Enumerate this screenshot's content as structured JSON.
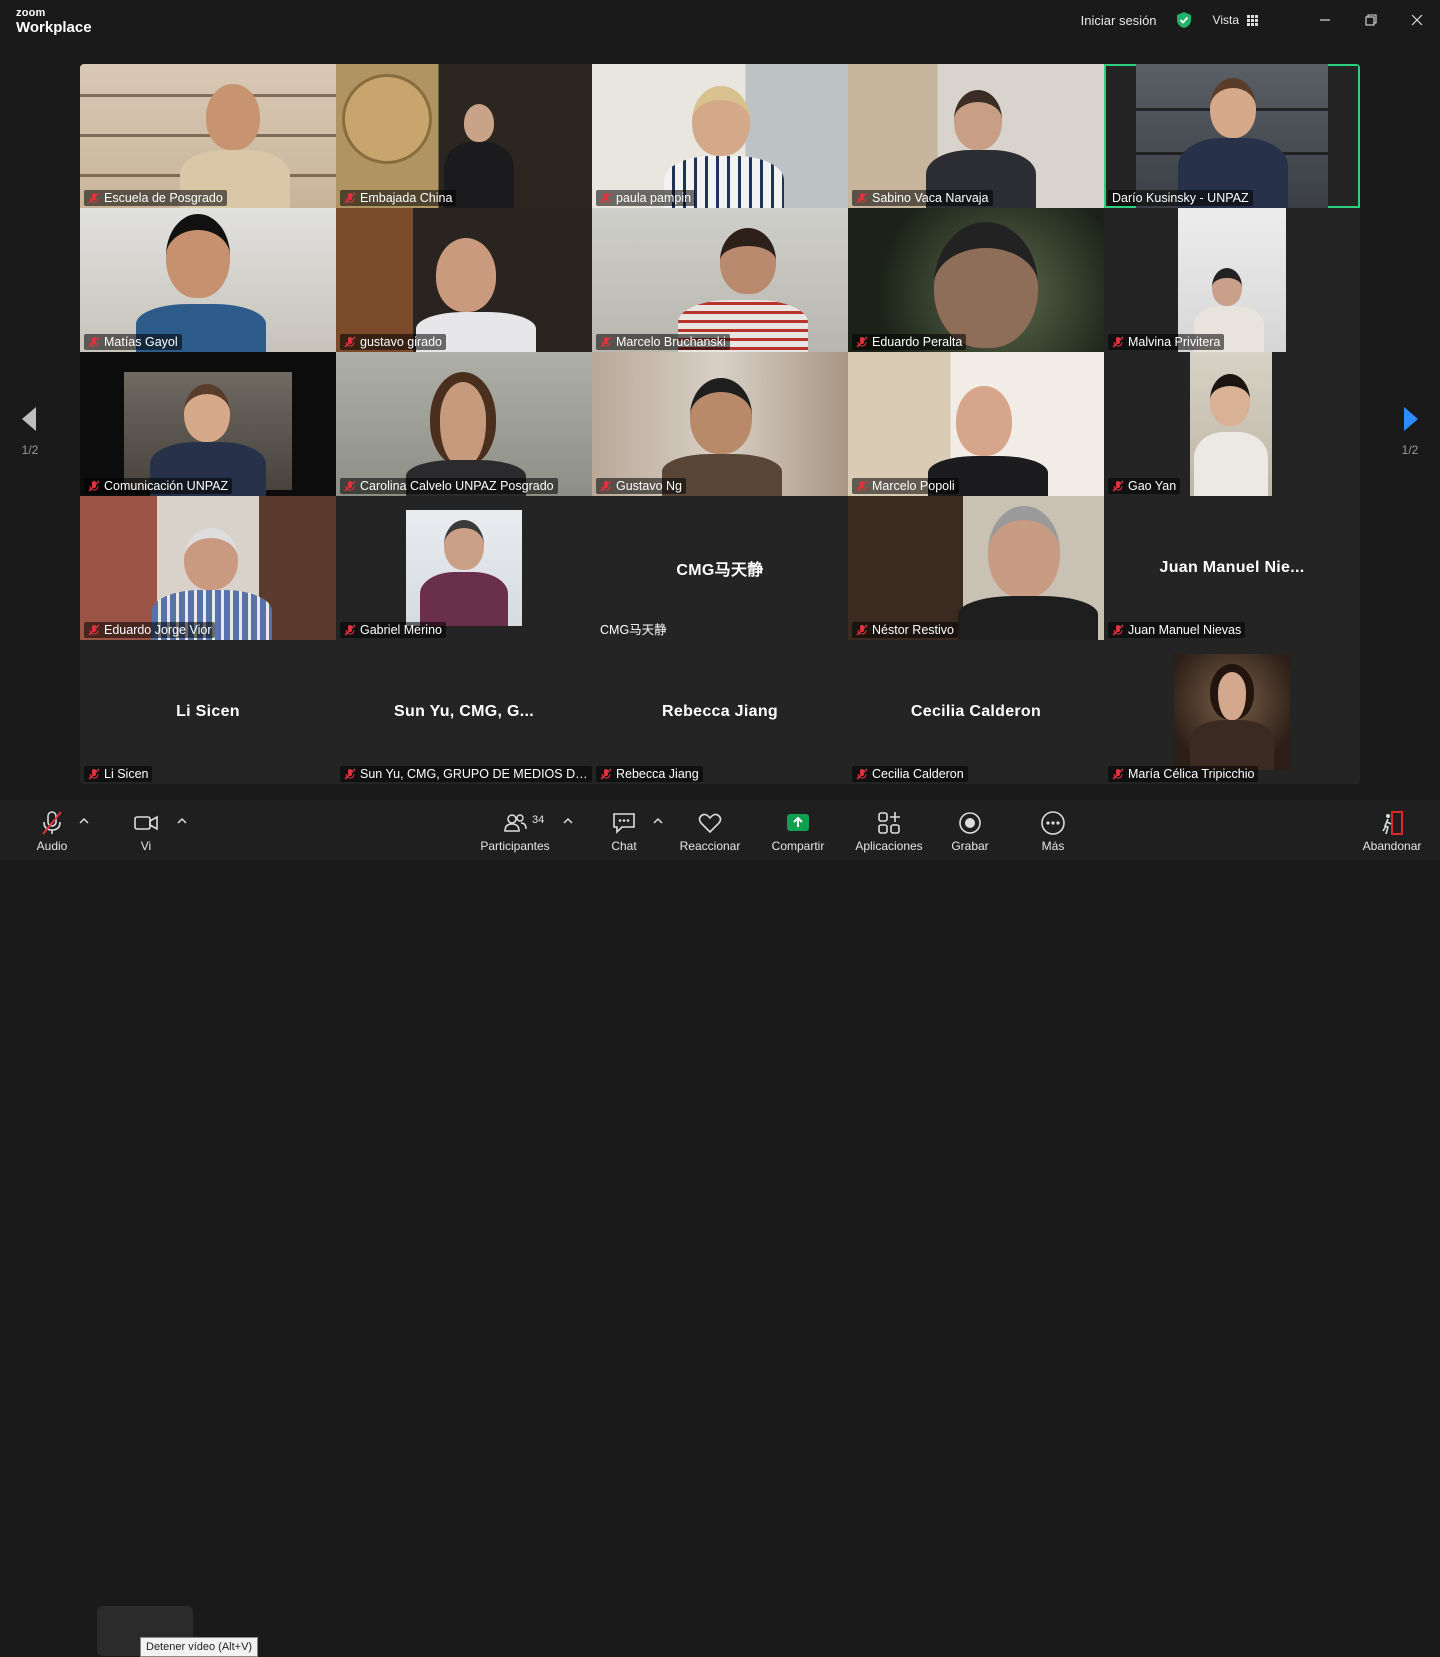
{
  "app": {
    "brand_small": "zoom",
    "brand_large": "Workplace"
  },
  "titlebar": {
    "signin": "Iniciar sesión",
    "view": "Vista"
  },
  "pager": {
    "left": "1/2",
    "right": "1/2"
  },
  "participants": [
    {
      "name": "Escuela de Posgrado",
      "muted": true,
      "video": true
    },
    {
      "name": "Embajada China",
      "muted": true,
      "video": true
    },
    {
      "name": "paula pampin",
      "muted": true,
      "video": true
    },
    {
      "name": "Sabino Vaca Narvaja",
      "muted": true,
      "video": true
    },
    {
      "name": "Darío Kusinsky - UNPAZ",
      "muted": false,
      "video": true,
      "active": true
    },
    {
      "name": "Matías Gayol",
      "muted": true,
      "video": true
    },
    {
      "name": "gustavo girado",
      "muted": true,
      "video": true
    },
    {
      "name": "Marcelo Bruchanski",
      "muted": true,
      "video": true
    },
    {
      "name": "Eduardo Peralta",
      "muted": true,
      "video": true
    },
    {
      "name": "Malvina Privitera",
      "muted": true,
      "video": true
    },
    {
      "name": "Comunicación UNPAZ",
      "muted": true,
      "video": true
    },
    {
      "name": "Carolina Calvelo UNPAZ Posgrado",
      "muted": true,
      "video": true
    },
    {
      "name": "Gustavo Ng",
      "muted": true,
      "video": true
    },
    {
      "name": "Marcelo Popoli",
      "muted": true,
      "video": true
    },
    {
      "name": "Gao Yan",
      "muted": true,
      "video": true
    },
    {
      "name": "Eduardo Jorge Vior",
      "muted": true,
      "video": true
    },
    {
      "name": "Gabriel Merino",
      "muted": true,
      "video": true
    },
    {
      "name": "CMG马天静",
      "muted": false,
      "video": false,
      "display": "CMG马天静"
    },
    {
      "name": "Néstor Restivo",
      "muted": true,
      "video": true
    },
    {
      "name": "Juan Manuel Nievas",
      "muted": true,
      "video": false,
      "display": "Juan Manuel Nie..."
    },
    {
      "name": "Li Sicen",
      "muted": true,
      "video": false,
      "display": "Li Sicen"
    },
    {
      "name": "Sun Yu, CMG, GRUPO DE MEDIOS DE ...",
      "muted": true,
      "video": false,
      "display": "Sun Yu, CMG, G..."
    },
    {
      "name": "Rebecca Jiang",
      "muted": true,
      "video": false,
      "display": "Rebecca Jiang"
    },
    {
      "name": "Cecilia Calderon",
      "muted": true,
      "video": false,
      "display": "Cecilia Calderon"
    },
    {
      "name": "María Célica Tripicchio",
      "muted": true,
      "video": true
    }
  ],
  "toolbar": {
    "audio": "Audio",
    "video": "Vi",
    "participants": "Participantes",
    "participants_count": "34",
    "chat": "Chat",
    "react": "Reaccionar",
    "share": "Compartir",
    "apps": "Aplicaciones",
    "record": "Grabar",
    "more": "Más",
    "leave": "Abandonar",
    "tooltip": "Detener vídeo (Alt+V)"
  },
  "colors": {
    "active_border": "#2fcf7f",
    "share_green": "#0e9f4f",
    "leave_red": "#e02828",
    "muted_red": "#e0323e"
  }
}
